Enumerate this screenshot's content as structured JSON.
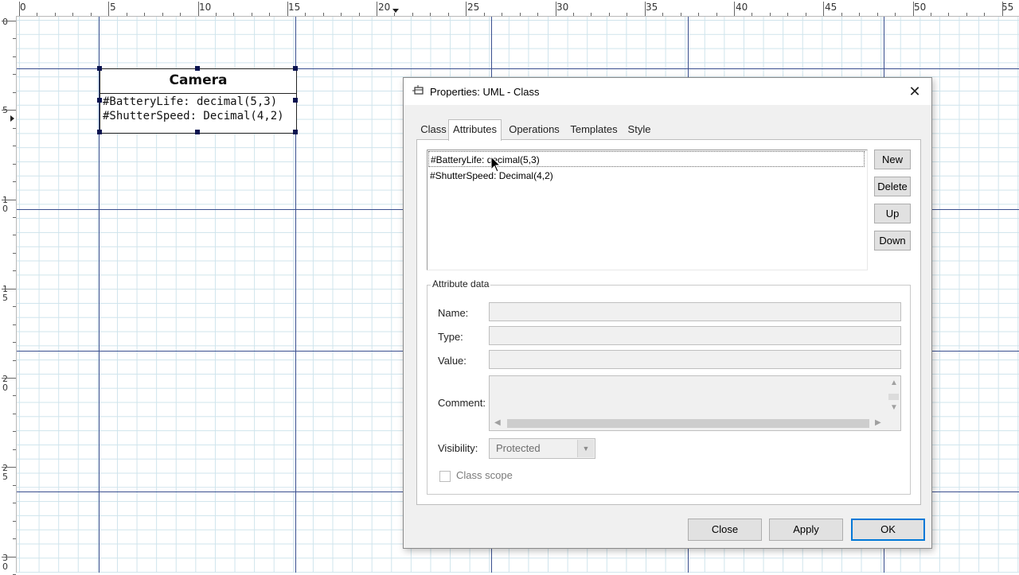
{
  "ruler": {
    "top_labels": [
      "0",
      "5",
      "10",
      "15",
      "20",
      "25",
      "30",
      "35",
      "40",
      "45",
      "50",
      "55"
    ],
    "left_labels": [
      "0",
      "5",
      "10",
      "15",
      "20",
      "25",
      "30"
    ]
  },
  "uml_class": {
    "name": "Camera",
    "attributes": [
      "#BatteryLife: decimal(5,3)",
      "#ShutterSpeed: Decimal(4,2)"
    ]
  },
  "dialog": {
    "title": "Properties: UML - Class",
    "title_icon": "uml-class-icon",
    "close_symbol": "✕",
    "tabs": [
      {
        "label": "Class",
        "active": false
      },
      {
        "label": "Attributes",
        "active": true
      },
      {
        "label": "Operations",
        "active": false
      },
      {
        "label": "Templates",
        "active": false
      },
      {
        "label": "Style",
        "active": false
      }
    ],
    "attribute_list": {
      "items": [
        "#BatteryLife: decimal(5,3)",
        "#ShutterSpeed: Decimal(4,2)"
      ],
      "selected_index": 0
    },
    "side_buttons": {
      "new": "New",
      "delete": "Delete",
      "up": "Up",
      "down": "Down"
    },
    "attribute_data": {
      "group_title": "Attribute data",
      "name_label": "Name:",
      "name_value": "",
      "type_label": "Type:",
      "type_value": "",
      "value_label": "Value:",
      "value_value": "",
      "comment_label": "Comment:",
      "comment_value": "",
      "visibility_label": "Visibility:",
      "visibility_value": "Protected",
      "class_scope_label": "Class scope",
      "class_scope_checked": false
    },
    "footer": {
      "close": "Close",
      "apply": "Apply",
      "ok": "OK"
    }
  },
  "colors": {
    "accent": "#0078d7",
    "diagram_line": "#3a4f8f",
    "grid": "#cfe4ec",
    "handle": "#0b1450"
  }
}
